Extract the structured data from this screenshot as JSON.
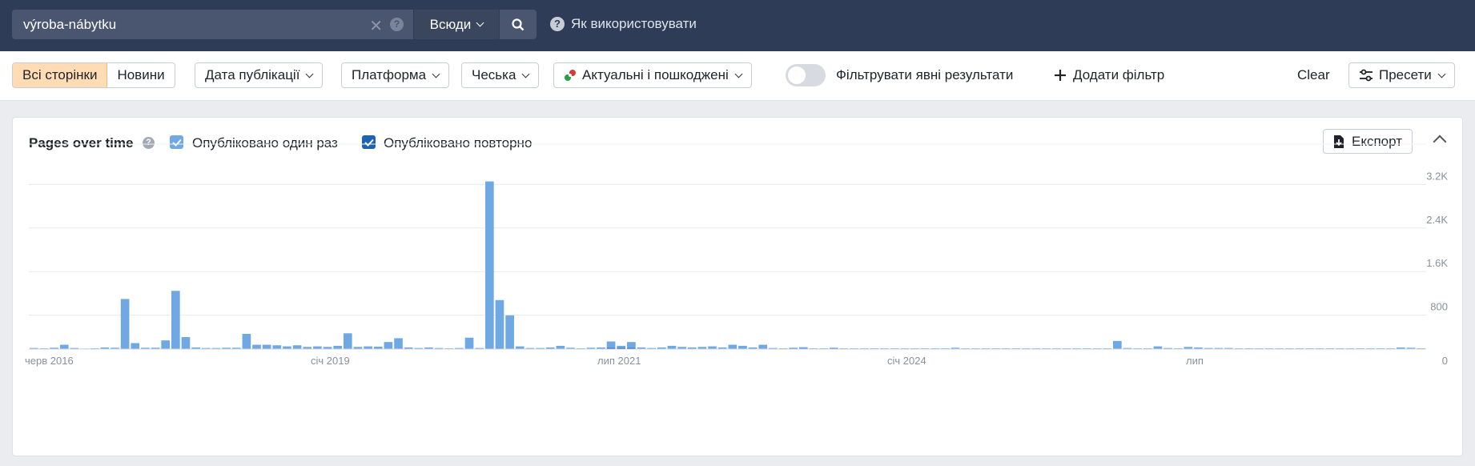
{
  "topbar": {
    "search_value": "výroba-nábytku",
    "scope_label": "Всюди",
    "howto_label": "Як використовувати"
  },
  "filters": {
    "segment": [
      "Всі сторінки",
      "Новини"
    ],
    "publish_date": "Дата публікації",
    "platform": "Платформа",
    "language": "Чеська",
    "status": "Актуальні і пошкоджені",
    "explicit_toggle": "Фільтрувати явні результати",
    "add_filter": "Додати фільтр",
    "clear": "Clear",
    "presets": "Пресети"
  },
  "card": {
    "title": "Pages over time",
    "legend_once": "Опубліковано один раз",
    "legend_repeat": "Опубліковано повторно",
    "export": "Експорт"
  },
  "colors": {
    "once": "#6fa8e3",
    "repeat": "#1f62b4",
    "accent_segment": "#ffdcb3",
    "topbar": "#2e3c57"
  },
  "chart_data": {
    "type": "bar",
    "x_tick_labels": [
      "черв 2016",
      "січ 2019",
      "лип 2021",
      "січ 2024",
      "лип"
    ],
    "y_tick_labels": [
      "0",
      "800",
      "1.6K",
      "2.4K",
      "3.2K"
    ],
    "ylim": [
      0,
      3500
    ],
    "grid": true,
    "series": [
      {
        "name": "Опубліковано один раз",
        "values": [
          20,
          15,
          25,
          80,
          20,
          10,
          15,
          30,
          25,
          920,
          110,
          25,
          25,
          160,
          1070,
          220,
          30,
          20,
          20,
          25,
          25,
          280,
          80,
          80,
          70,
          50,
          70,
          40,
          50,
          40,
          60,
          290,
          40,
          50,
          45,
          130,
          200,
          30,
          20,
          30,
          20,
          15,
          20,
          210,
          20,
          3080,
          900,
          620,
          50,
          20,
          20,
          30,
          60,
          25,
          15,
          25,
          30,
          120,
          40,
          110,
          30,
          20,
          30,
          60,
          40,
          30,
          40,
          50,
          30,
          80,
          60,
          30,
          80,
          20,
          15,
          15,
          25,
          15,
          15,
          15,
          15,
          15,
          15,
          15,
          15,
          15,
          15,
          15,
          15,
          15,
          15,
          25,
          15,
          15,
          15,
          15,
          15,
          15,
          15,
          15,
          15,
          15,
          15,
          15,
          15,
          15,
          15,
          150,
          20,
          15,
          15,
          50,
          20,
          15,
          40,
          30,
          20,
          20,
          20,
          15,
          15,
          15,
          15,
          15,
          15,
          15,
          15,
          15,
          15,
          15,
          15,
          15,
          15,
          15,
          15,
          30,
          25,
          15
        ]
      },
      {
        "name": "Опубліковано повторно",
        "values": [
          0,
          0,
          0,
          0,
          0,
          0,
          0,
          0,
          0,
          0,
          0,
          0,
          0,
          0,
          0,
          0,
          0,
          0,
          0,
          0,
          0,
          0,
          0,
          0,
          0,
          0,
          0,
          0,
          0,
          0,
          0,
          0,
          0,
          0,
          0,
          0,
          0,
          0,
          0,
          0,
          0,
          0,
          0,
          0,
          0,
          0,
          0,
          0,
          0,
          0,
          0,
          0,
          0,
          0,
          0,
          0,
          0,
          20,
          20,
          20,
          0,
          0,
          0,
          0,
          0,
          0,
          0,
          0,
          0,
          0,
          0,
          0,
          0,
          0,
          0,
          10,
          10,
          0,
          0,
          10,
          0,
          0,
          0,
          0,
          0,
          0,
          0,
          0,
          0,
          0,
          0,
          0,
          0,
          0,
          0,
          0,
          0,
          0,
          0,
          0,
          0,
          0,
          0,
          0,
          0,
          0,
          0,
          0,
          0,
          0,
          0,
          0,
          0,
          0,
          0,
          0,
          0,
          0,
          0,
          0,
          0,
          0,
          0,
          0,
          0,
          0,
          0,
          0,
          0,
          0,
          0,
          0,
          0,
          0,
          0,
          0,
          0,
          0
        ]
      }
    ]
  }
}
